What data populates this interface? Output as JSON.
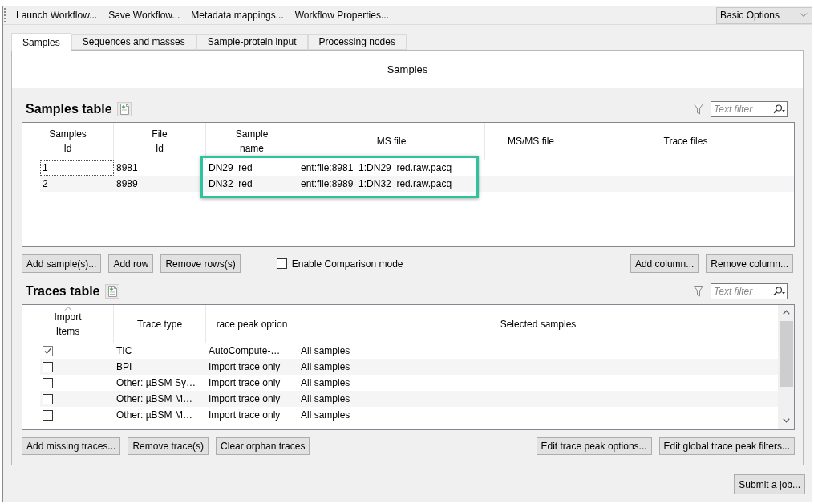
{
  "toolbar": {
    "actions": [
      "Launch Workflow...",
      "Save Workflow...",
      "Metadata mappings...",
      "Workflow Properties..."
    ],
    "mode_select": {
      "value": "Basic Options"
    }
  },
  "tabs": [
    {
      "label": "Samples",
      "selected": true
    },
    {
      "label": "Sequences and masses",
      "selected": false
    },
    {
      "label": "Sample-protein input",
      "selected": false
    },
    {
      "label": "Processing nodes",
      "selected": false
    }
  ],
  "panel": {
    "title": "Samples"
  },
  "samples_table": {
    "title": "Samples table",
    "filter": {
      "placeholder": "Text filter"
    },
    "columns": [
      {
        "label": "Samples\nId",
        "highlighted": false
      },
      {
        "label": "File\nId",
        "highlighted": false
      },
      {
        "label": "Sample\nname",
        "highlighted": true
      },
      {
        "label": "MS file",
        "highlighted": true
      },
      {
        "label": "MS/MS file",
        "highlighted": false
      },
      {
        "label": "Trace files",
        "highlighted": false
      }
    ],
    "rows": [
      {
        "focused": true,
        "cells": [
          "1",
          "8981",
          "DN29_red",
          "ent:file:8981_1:DN29_red.raw.pacq"
        ]
      },
      {
        "focused": false,
        "cells": [
          "2",
          "8989",
          "DN32_red",
          "ent:file:8989_1:DN32_red.raw.pacq"
        ]
      }
    ],
    "buttons": [
      "Add sample(s)...",
      "Add row",
      "Remove rows(s)"
    ],
    "comparison_mode": {
      "label": "Enable Comparison mode",
      "checked": false
    },
    "column_buttons": [
      "Add column...",
      "Remove column..."
    ]
  },
  "traces_table": {
    "title": "Traces table",
    "filter": {
      "placeholder": "Text filter"
    },
    "columns": [
      {
        "label": "Import\nItems",
        "sorted": true
      },
      {
        "label": "Trace type",
        "sorted": false
      },
      {
        "label": "race peak option",
        "sorted": false
      },
      {
        "label": "Selected samples",
        "sorted": false
      }
    ],
    "rows": [
      {
        "checked": true,
        "cells": [
          "",
          "TIC",
          "AutoCompute-…",
          "All samples"
        ]
      },
      {
        "checked": false,
        "cells": [
          "",
          "BPI",
          "Import trace only",
          "All samples"
        ]
      },
      {
        "checked": false,
        "cells": [
          "",
          "Other: µBSM Sy…",
          "Import trace only",
          "All samples"
        ]
      },
      {
        "checked": false,
        "cells": [
          "",
          "Other: µBSM M…",
          "Import trace only",
          "All samples"
        ]
      },
      {
        "checked": false,
        "cells": [
          "",
          "Other: µBSM M…",
          "Import trace only",
          "All samples"
        ]
      }
    ],
    "buttons": [
      "Add missing traces...",
      "Remove trace(s)",
      "Clear orphan traces"
    ],
    "option_buttons": [
      "Edit trace peak options...",
      "Edit global trace peak filters..."
    ]
  },
  "submit_button": "Submit a job..."
}
